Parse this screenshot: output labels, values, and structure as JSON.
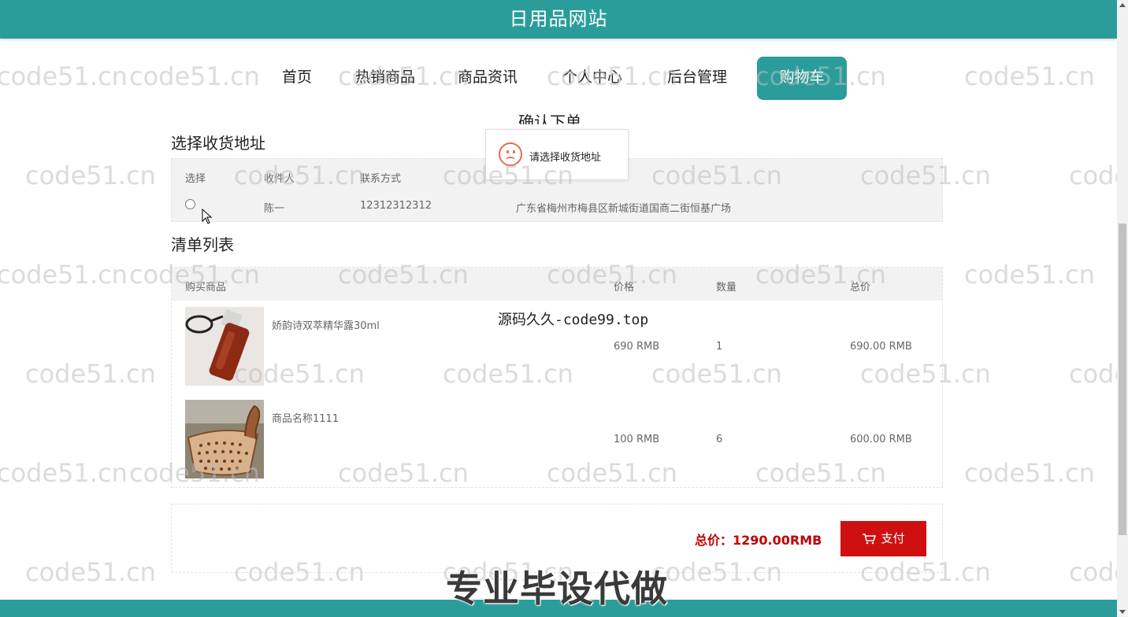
{
  "header": {
    "site_title": "日用品网站"
  },
  "nav": {
    "items": [
      {
        "label": "首页"
      },
      {
        "label": "热销商品"
      },
      {
        "label": "商品资讯"
      },
      {
        "label": "个人中心"
      },
      {
        "label": "后台管理"
      },
      {
        "label": "购物车",
        "active": true
      }
    ]
  },
  "page": {
    "heading": "确认下单"
  },
  "toast": {
    "message": "请选择收货地址",
    "icon": "sad-face-icon"
  },
  "address": {
    "section_title": "选择收货地址",
    "columns": [
      "选择",
      "收件人",
      "联系方式"
    ],
    "rows": [
      {
        "selected": false,
        "recipient": "陈一",
        "phone": "12312312312",
        "address": "广东省梅州市梅县区新城街道国商二街恒基广场"
      }
    ]
  },
  "order_list": {
    "section_title": "清单列表",
    "columns": [
      "购买商品",
      "价格",
      "数量",
      "总价"
    ],
    "items": [
      {
        "name": "娇韵诗双萃精华露30ml",
        "price": "690 RMB",
        "quantity": "1",
        "total": "690.00 RMB"
      },
      {
        "name": "商品名称1111",
        "price": "100 RMB",
        "quantity": "6",
        "total": "600.00 RMB"
      }
    ]
  },
  "summary": {
    "total_label": "总价：1290.00RMB",
    "pay_label": "支付"
  },
  "overlays": {
    "watermark_text": "code51.cn",
    "source_text": "源码久久-code99.top",
    "banner_text": "专业毕设代做"
  },
  "colors": {
    "primary": "#2a9d9b",
    "pay": "#d01010",
    "total": "#c00000"
  }
}
